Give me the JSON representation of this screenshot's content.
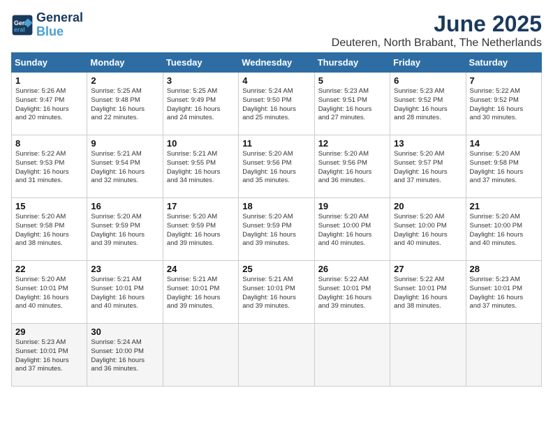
{
  "logo": {
    "line1": "General",
    "line2": "Blue"
  },
  "title": "June 2025",
  "subtitle": "Deuteren, North Brabant, The Netherlands",
  "days_of_week": [
    "Sunday",
    "Monday",
    "Tuesday",
    "Wednesday",
    "Thursday",
    "Friday",
    "Saturday"
  ],
  "weeks": [
    [
      {
        "day": "1",
        "info": "Sunrise: 5:26 AM\nSunset: 9:47 PM\nDaylight: 16 hours\nand 20 minutes."
      },
      {
        "day": "2",
        "info": "Sunrise: 5:25 AM\nSunset: 9:48 PM\nDaylight: 16 hours\nand 22 minutes."
      },
      {
        "day": "3",
        "info": "Sunrise: 5:25 AM\nSunset: 9:49 PM\nDaylight: 16 hours\nand 24 minutes."
      },
      {
        "day": "4",
        "info": "Sunrise: 5:24 AM\nSunset: 9:50 PM\nDaylight: 16 hours\nand 25 minutes."
      },
      {
        "day": "5",
        "info": "Sunrise: 5:23 AM\nSunset: 9:51 PM\nDaylight: 16 hours\nand 27 minutes."
      },
      {
        "day": "6",
        "info": "Sunrise: 5:23 AM\nSunset: 9:52 PM\nDaylight: 16 hours\nand 28 minutes."
      },
      {
        "day": "7",
        "info": "Sunrise: 5:22 AM\nSunset: 9:52 PM\nDaylight: 16 hours\nand 30 minutes."
      }
    ],
    [
      {
        "day": "8",
        "info": "Sunrise: 5:22 AM\nSunset: 9:53 PM\nDaylight: 16 hours\nand 31 minutes."
      },
      {
        "day": "9",
        "info": "Sunrise: 5:21 AM\nSunset: 9:54 PM\nDaylight: 16 hours\nand 32 minutes."
      },
      {
        "day": "10",
        "info": "Sunrise: 5:21 AM\nSunset: 9:55 PM\nDaylight: 16 hours\nand 34 minutes."
      },
      {
        "day": "11",
        "info": "Sunrise: 5:20 AM\nSunset: 9:56 PM\nDaylight: 16 hours\nand 35 minutes."
      },
      {
        "day": "12",
        "info": "Sunrise: 5:20 AM\nSunset: 9:56 PM\nDaylight: 16 hours\nand 36 minutes."
      },
      {
        "day": "13",
        "info": "Sunrise: 5:20 AM\nSunset: 9:57 PM\nDaylight: 16 hours\nand 37 minutes."
      },
      {
        "day": "14",
        "info": "Sunrise: 5:20 AM\nSunset: 9:58 PM\nDaylight: 16 hours\nand 37 minutes."
      }
    ],
    [
      {
        "day": "15",
        "info": "Sunrise: 5:20 AM\nSunset: 9:58 PM\nDaylight: 16 hours\nand 38 minutes."
      },
      {
        "day": "16",
        "info": "Sunrise: 5:20 AM\nSunset: 9:59 PM\nDaylight: 16 hours\nand 39 minutes."
      },
      {
        "day": "17",
        "info": "Sunrise: 5:20 AM\nSunset: 9:59 PM\nDaylight: 16 hours\nand 39 minutes."
      },
      {
        "day": "18",
        "info": "Sunrise: 5:20 AM\nSunset: 9:59 PM\nDaylight: 16 hours\nand 39 minutes."
      },
      {
        "day": "19",
        "info": "Sunrise: 5:20 AM\nSunset: 10:00 PM\nDaylight: 16 hours\nand 40 minutes."
      },
      {
        "day": "20",
        "info": "Sunrise: 5:20 AM\nSunset: 10:00 PM\nDaylight: 16 hours\nand 40 minutes."
      },
      {
        "day": "21",
        "info": "Sunrise: 5:20 AM\nSunset: 10:00 PM\nDaylight: 16 hours\nand 40 minutes."
      }
    ],
    [
      {
        "day": "22",
        "info": "Sunrise: 5:20 AM\nSunset: 10:01 PM\nDaylight: 16 hours\nand 40 minutes."
      },
      {
        "day": "23",
        "info": "Sunrise: 5:21 AM\nSunset: 10:01 PM\nDaylight: 16 hours\nand 40 minutes."
      },
      {
        "day": "24",
        "info": "Sunrise: 5:21 AM\nSunset: 10:01 PM\nDaylight: 16 hours\nand 39 minutes."
      },
      {
        "day": "25",
        "info": "Sunrise: 5:21 AM\nSunset: 10:01 PM\nDaylight: 16 hours\nand 39 minutes."
      },
      {
        "day": "26",
        "info": "Sunrise: 5:22 AM\nSunset: 10:01 PM\nDaylight: 16 hours\nand 39 minutes."
      },
      {
        "day": "27",
        "info": "Sunrise: 5:22 AM\nSunset: 10:01 PM\nDaylight: 16 hours\nand 38 minutes."
      },
      {
        "day": "28",
        "info": "Sunrise: 5:23 AM\nSunset: 10:01 PM\nDaylight: 16 hours\nand 37 minutes."
      }
    ],
    [
      {
        "day": "29",
        "info": "Sunrise: 5:23 AM\nSunset: 10:01 PM\nDaylight: 16 hours\nand 37 minutes."
      },
      {
        "day": "30",
        "info": "Sunrise: 5:24 AM\nSunset: 10:00 PM\nDaylight: 16 hours\nand 36 minutes."
      },
      null,
      null,
      null,
      null,
      null
    ]
  ]
}
